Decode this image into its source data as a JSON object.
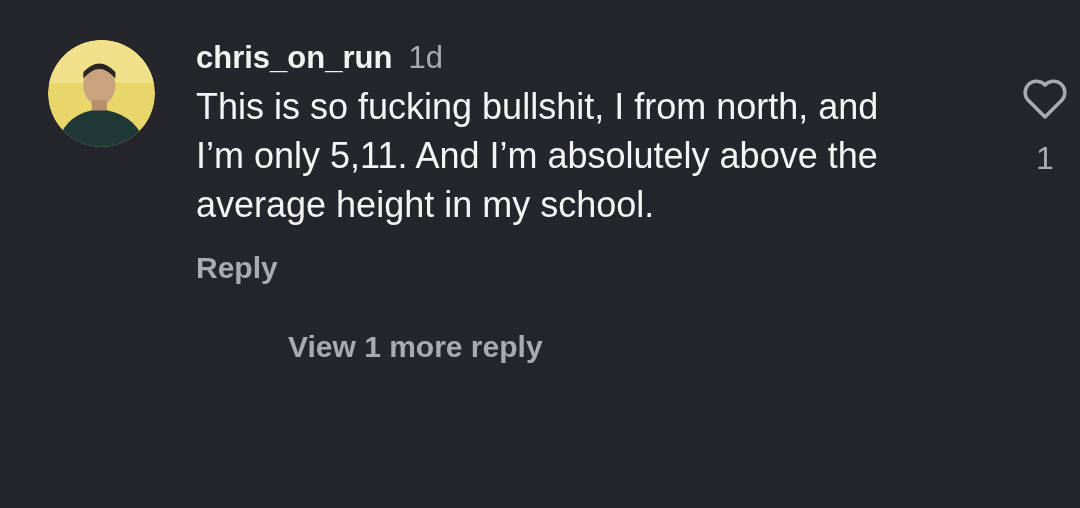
{
  "comment": {
    "username": "chris_on_run",
    "time": "1d",
    "text": "This is so fucking bullshit, I from north, and I’m only 5,11. And I’m absolutely above the average height in my school.",
    "reply_label": "Reply",
    "liked": false,
    "like_count": "1"
  },
  "view_replies": "View 1 more reply"
}
